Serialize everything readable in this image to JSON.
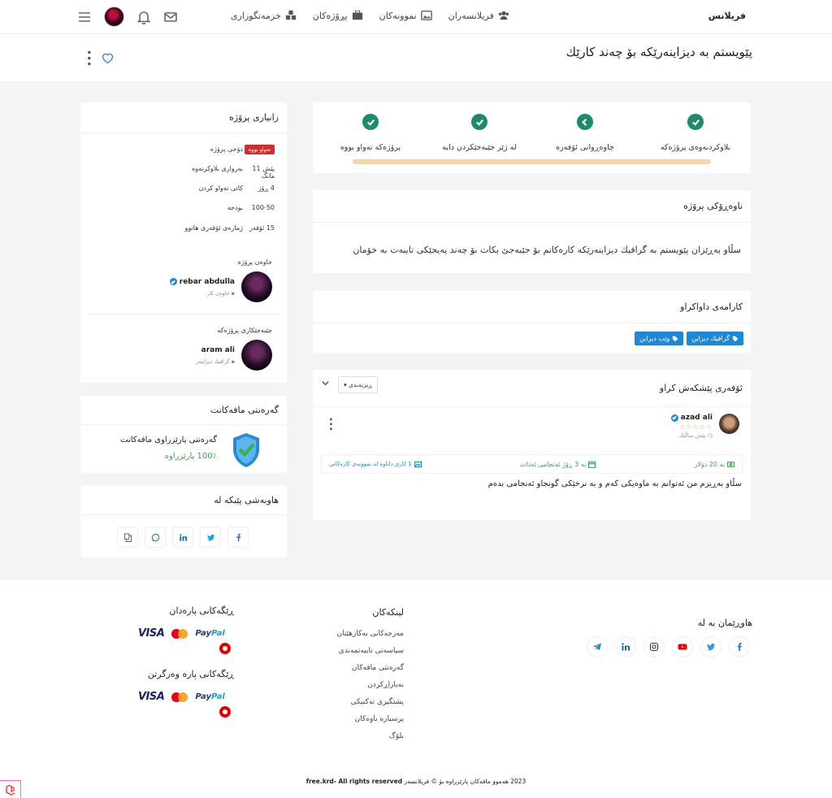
{
  "header": {
    "brand": "فریلانس",
    "nav": [
      {
        "label": "خزمەتگوزاری",
        "icon": "services-icon"
      },
      {
        "label": "پڕۆژەکان",
        "icon": "briefcase-icon"
      },
      {
        "label": "نموونەکان",
        "icon": "image-icon"
      },
      {
        "label": "فریلانسەران",
        "icon": "users-icon"
      }
    ]
  },
  "page": {
    "title": "پێویستم بە دیزاینەرێکە بۆ چەند کارێك"
  },
  "progress": {
    "steps": [
      "بلاوکردنەوەی پرۆژەکە",
      "چاوەڕوانی ئۆفەرە",
      "لە ژێر جێبەجێکردن دایە",
      "پرۆژەکە تەواو بووە"
    ],
    "value": 1.0
  },
  "description": {
    "heading": "ناوەڕۆکی پرۆژە",
    "text": "سڵاو بەڕێزان پێویستم بە گرافیك دیزاینەرێکە کارەکانم بۆ جێبەجێ بکات بۆ چەند پەیجێکی تایبەت بە خۆمان"
  },
  "skills": {
    "heading": "کارامەی داواکراو",
    "items": [
      "گرافیك دیزاین",
      "وێب دیزاین"
    ]
  },
  "offers": {
    "heading": "ئۆفەری پێشکەش کراو",
    "sort_label": "ڕیزبەندی",
    "items": [
      {
        "name": "azad ali",
        "rating": 0,
        "stars": "☆☆☆☆☆",
        "time": "پێش ساڵێك",
        "price": "بە 20 دۆلار",
        "duration": "بە 3 ڕۆژ ئەنجامی ئەدات",
        "portfolio": "1 کاری داناوە لە نموونەی کارەکانی",
        "text": "سڵاو بەڕیزم من ئەتوانم بە ماوەیکی کەم و بە نرخێکی گونجاو ئەنجامی بدەم"
      }
    ]
  },
  "project_info": {
    "heading": "زانیاری پرۆژە",
    "rows": [
      {
        "key": "دۆخی پرۆژە",
        "value": "تەواو بووە",
        "badge": true
      },
      {
        "key": "بەرواری بلاوکرنەوە",
        "value": "پێش 11 مانگ"
      },
      {
        "key": "کاتی تەواو کردن",
        "value": "4 ڕۆژ"
      },
      {
        "key": "بودجە",
        "value": "100-50"
      },
      {
        "key": "ژمارەی ئۆفەری هاتوو",
        "value": "15 ئۆفەر"
      }
    ],
    "owner_title": "خاوەن پرۆژە",
    "owner_name": "rebar abdulla",
    "owner_role": "خاوەن کار",
    "executor_title": "جێبەجێکاری پرۆژەکە",
    "executor_name": "aram ali",
    "executor_role": "گرافیك دیزاینەر"
  },
  "guarantee": {
    "heading": "گەرەنتی مافەکانت",
    "line1": "گەرەنتی پارێزراوی مافەکانت",
    "line2": "100٪ پارێزراوە"
  },
  "share": {
    "heading": "هاوبەشی پێبکە لە",
    "buttons": [
      "facebook-icon",
      "twitter-icon",
      "linkedin-icon",
      "whatsapp-icon",
      "copy-icon"
    ]
  },
  "footer": {
    "follow_heading": "هاوڕێمان بە لە",
    "links_heading": "لینکەکان",
    "links": [
      "مەرجەکانی بەکارهێنان",
      "سیاسەتی تایبەتمەندی",
      "گەرەنتی مافەکان",
      "بەبازاڕکردن",
      "پشتگیری تەکنیکی",
      "پرسیارە باوەکان",
      "بلۆگ"
    ],
    "payment_heading": "ڕێگەکانی پارەدان",
    "receive_heading": "ڕێگەکانی پارە وەرگرتن",
    "visa": "VISA",
    "paypal_a": "Pay",
    "paypal_b": "Pal",
    "copyright_a": "free.krd",
    "copyright_b": "- All rights reserved",
    "copyright_c": "2023 هەموو مافەکان پارێزراوە بۆ © فریلانسەر"
  },
  "colors": {
    "accent": "#1d8a6e",
    "blue": "#1e88d6",
    "progress": "#f5d7ad",
    "danger": "#d42b2b",
    "success": "#3aa64a"
  }
}
